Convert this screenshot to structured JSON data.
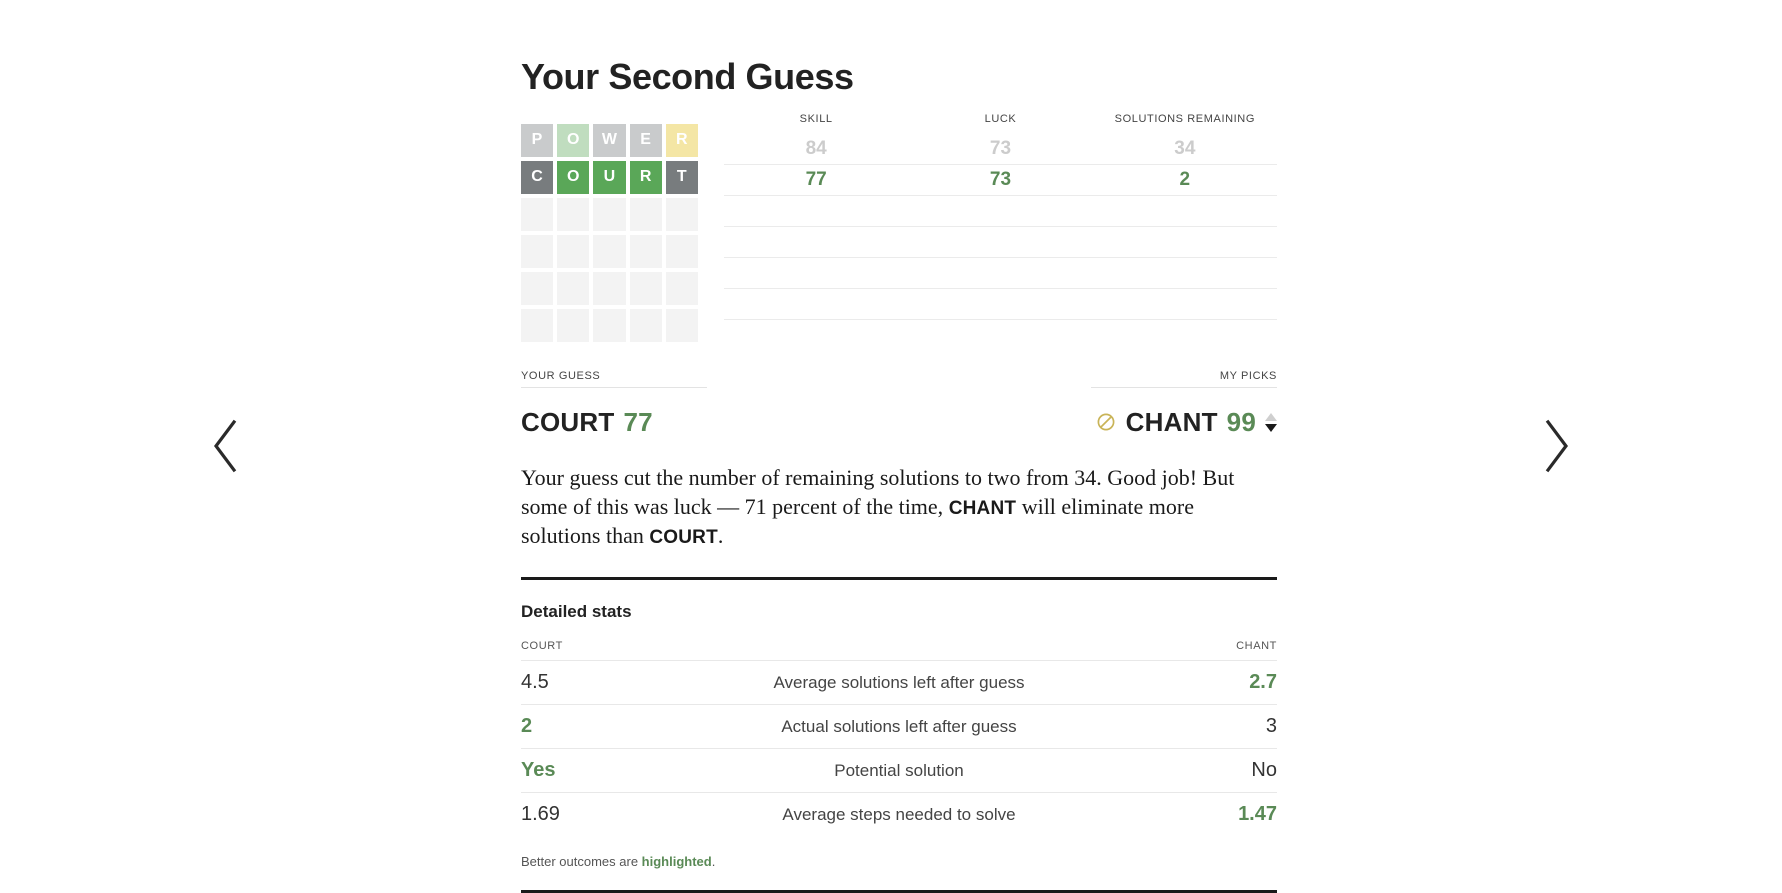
{
  "nav": {
    "prev_label": "Previous",
    "prev_icon": "chevron-left-icon",
    "next_label": "Next",
    "next_icon": "chevron-right-icon"
  },
  "header": {
    "title": "Your Second Guess"
  },
  "board": {
    "rows": [
      {
        "word": "POWER",
        "faded": true,
        "tiles": [
          {
            "letter": "P",
            "state": "absent"
          },
          {
            "letter": "O",
            "state": "correct"
          },
          {
            "letter": "W",
            "state": "absent"
          },
          {
            "letter": "E",
            "state": "absent"
          },
          {
            "letter": "R",
            "state": "present"
          }
        ]
      },
      {
        "word": "COURT",
        "faded": false,
        "tiles": [
          {
            "letter": "C",
            "state": "absent"
          },
          {
            "letter": "O",
            "state": "correct"
          },
          {
            "letter": "U",
            "state": "correct"
          },
          {
            "letter": "R",
            "state": "correct"
          },
          {
            "letter": "T",
            "state": "absent"
          }
        ]
      },
      {
        "word": "",
        "faded": false,
        "tiles": [
          {
            "letter": "",
            "state": "empty"
          },
          {
            "letter": "",
            "state": "empty"
          },
          {
            "letter": "",
            "state": "empty"
          },
          {
            "letter": "",
            "state": "empty"
          },
          {
            "letter": "",
            "state": "empty"
          }
        ]
      },
      {
        "word": "",
        "faded": false,
        "tiles": [
          {
            "letter": "",
            "state": "empty"
          },
          {
            "letter": "",
            "state": "empty"
          },
          {
            "letter": "",
            "state": "empty"
          },
          {
            "letter": "",
            "state": "empty"
          },
          {
            "letter": "",
            "state": "empty"
          }
        ]
      },
      {
        "word": "",
        "faded": false,
        "tiles": [
          {
            "letter": "",
            "state": "empty"
          },
          {
            "letter": "",
            "state": "empty"
          },
          {
            "letter": "",
            "state": "empty"
          },
          {
            "letter": "",
            "state": "empty"
          },
          {
            "letter": "",
            "state": "empty"
          }
        ]
      },
      {
        "word": "",
        "faded": false,
        "tiles": [
          {
            "letter": "",
            "state": "empty"
          },
          {
            "letter": "",
            "state": "empty"
          },
          {
            "letter": "",
            "state": "empty"
          },
          {
            "letter": "",
            "state": "empty"
          },
          {
            "letter": "",
            "state": "empty"
          }
        ]
      }
    ]
  },
  "scoreboard": {
    "columns": [
      "SKILL",
      "LUCK",
      "SOLUTIONS REMAINING"
    ],
    "rows": [
      {
        "style": "faded",
        "values": [
          "84",
          "73",
          "34"
        ]
      },
      {
        "style": "active",
        "values": [
          "77",
          "73",
          "2"
        ]
      },
      {
        "style": "blank",
        "values": [
          "",
          "",
          ""
        ]
      },
      {
        "style": "blank",
        "values": [
          "",
          "",
          ""
        ]
      },
      {
        "style": "blank",
        "values": [
          "",
          "",
          ""
        ]
      },
      {
        "style": "blank",
        "values": [
          "",
          "",
          ""
        ]
      }
    ]
  },
  "picks": {
    "your_guess_label": "YOUR GUESS",
    "my_picks_label": "MY PICKS",
    "your_guess_word": "COURT",
    "your_guess_score": "77",
    "my_pick_icon": "no-entry-circle-icon",
    "my_pick_word": "CHANT",
    "my_pick_score": "99",
    "spinner_up_icon": "triangle-up-icon",
    "spinner_down_icon": "triangle-down-icon"
  },
  "narrative": {
    "part1": "Your guess cut the number of remaining solutions to two from 34. Good job! But some of this was luck — 71 percent of the time, ",
    "bold1": "CHANT",
    "part2": " will eliminate more solutions than ",
    "bold2": "COURT",
    "part3": "."
  },
  "detailed": {
    "title": "Detailed stats",
    "left_header": "COURT",
    "center_header": "",
    "right_header": "CHANT",
    "rows": [
      {
        "left": "4.5",
        "label": "Average solutions left after guess",
        "right": "2.7",
        "highlight": "right"
      },
      {
        "left": "2",
        "label": "Actual solutions left after guess",
        "right": "3",
        "highlight": "left"
      },
      {
        "left": "Yes",
        "label": "Potential solution",
        "right": "No",
        "highlight": "left"
      },
      {
        "left": "1.69",
        "label": "Average steps needed to solve",
        "right": "1.47",
        "highlight": "right"
      }
    ],
    "footnote_prefix": "Better outcomes are ",
    "footnote_bold": "highlighted",
    "footnote_suffix": "."
  },
  "colors": {
    "correct": "#5aa758",
    "present": "#c9b458",
    "absent": "#787c7e",
    "empty": "#f3f3f3",
    "accent_green": "#5a8a56",
    "faded": "#cccccc",
    "rule": "#1a1a1a"
  }
}
